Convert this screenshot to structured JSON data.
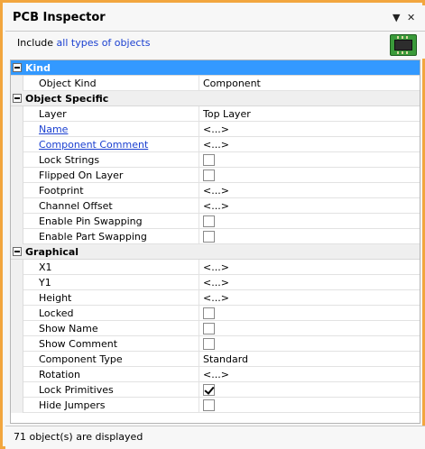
{
  "window": {
    "title": "PCB Inspector",
    "pin_glyph": "▼",
    "close_glyph": "✕"
  },
  "include": {
    "prefix": "Include ",
    "link": "all types of objects"
  },
  "icons": {
    "pcb": "pcb-board-icon"
  },
  "colors": {
    "frame": "#f2a63e",
    "selection": "#3399ff",
    "link": "#1a3fd0"
  },
  "sections": {
    "kind": {
      "label": "Kind",
      "rows": [
        {
          "name": "Object Kind",
          "value": "Component"
        }
      ]
    },
    "object_specific": {
      "label": "Object Specific",
      "rows": [
        {
          "name": "Layer",
          "value": "Top Layer"
        },
        {
          "name": "Name",
          "value": "<...>"
        },
        {
          "name": "Component Comment",
          "value": "<...>"
        },
        {
          "name": "Lock Strings",
          "checked": false
        },
        {
          "name": "Flipped On Layer",
          "checked": false
        },
        {
          "name": "Footprint",
          "value": "<...>"
        },
        {
          "name": "Channel Offset",
          "value": "<...>"
        },
        {
          "name": "Enable Pin Swapping",
          "checked": false
        },
        {
          "name": "Enable Part Swapping",
          "checked": false
        }
      ]
    },
    "graphical": {
      "label": "Graphical",
      "rows": [
        {
          "name": "X1",
          "value": "<...>"
        },
        {
          "name": "Y1",
          "value": "<...>"
        },
        {
          "name": "Height",
          "value": "<...>"
        },
        {
          "name": "Locked",
          "checked": false
        },
        {
          "name": "Show Name",
          "checked": false
        },
        {
          "name": "Show Comment",
          "checked": false
        },
        {
          "name": "Component Type",
          "value": "Standard"
        },
        {
          "name": "Rotation",
          "value": "<...>"
        },
        {
          "name": "Lock Primitives",
          "checked": true
        },
        {
          "name": "Hide Jumpers",
          "checked": false
        }
      ]
    }
  },
  "status": {
    "text": "71 object(s) are displayed"
  }
}
